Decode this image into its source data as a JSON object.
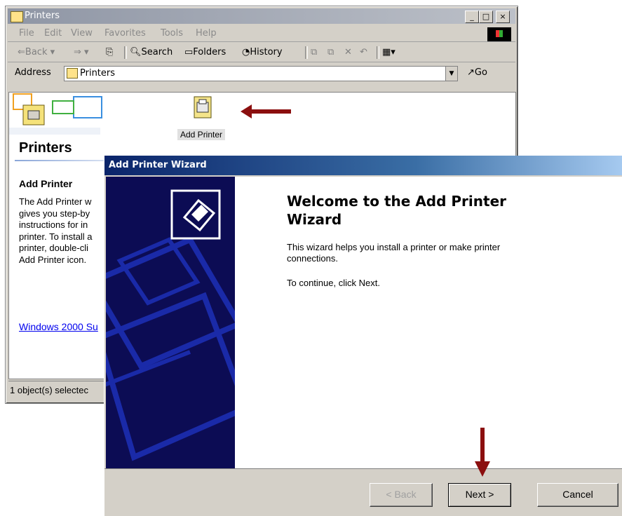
{
  "explorer": {
    "title": "Printers",
    "menu": [
      "File",
      "Edit",
      "View",
      "Favorites",
      "Tools",
      "Help"
    ],
    "toolbar": {
      "back": "Back",
      "search": "Search",
      "folders": "Folders",
      "history": "History"
    },
    "address_label": "Address",
    "address_value": "Printers",
    "go_label": "Go",
    "folder_heading": "Printers",
    "icon_label": "Add Printer",
    "info_title": "Add Printer",
    "info_lines": [
      "The Add Printer w",
      "gives you step-by",
      "instructions for in",
      "printer. To install a",
      "printer, double-cli",
      "Add Printer icon."
    ],
    "link_text": "Windows 2000 Su",
    "status_text": "1 object(s) selectec",
    "title_buttons": {
      "minimize": "_",
      "maximize": "□",
      "close": "×"
    }
  },
  "wizard": {
    "title": "Add Printer Wizard",
    "heading_line1": "Welcome to the Add Printer",
    "heading_line2": "Wizard",
    "body_line1": "This wizard helps you install a printer or make printer",
    "body_line2": "connections.",
    "continue_text": "To continue, click Next.",
    "back_button": "< Back",
    "next_button": "Next >",
    "cancel_button": "Cancel"
  },
  "colors": {
    "arrow": "#8b0f0f",
    "wizard_panel": "#0c0c54",
    "title_gradient_start": "#0a246a",
    "link": "#0000ee"
  }
}
